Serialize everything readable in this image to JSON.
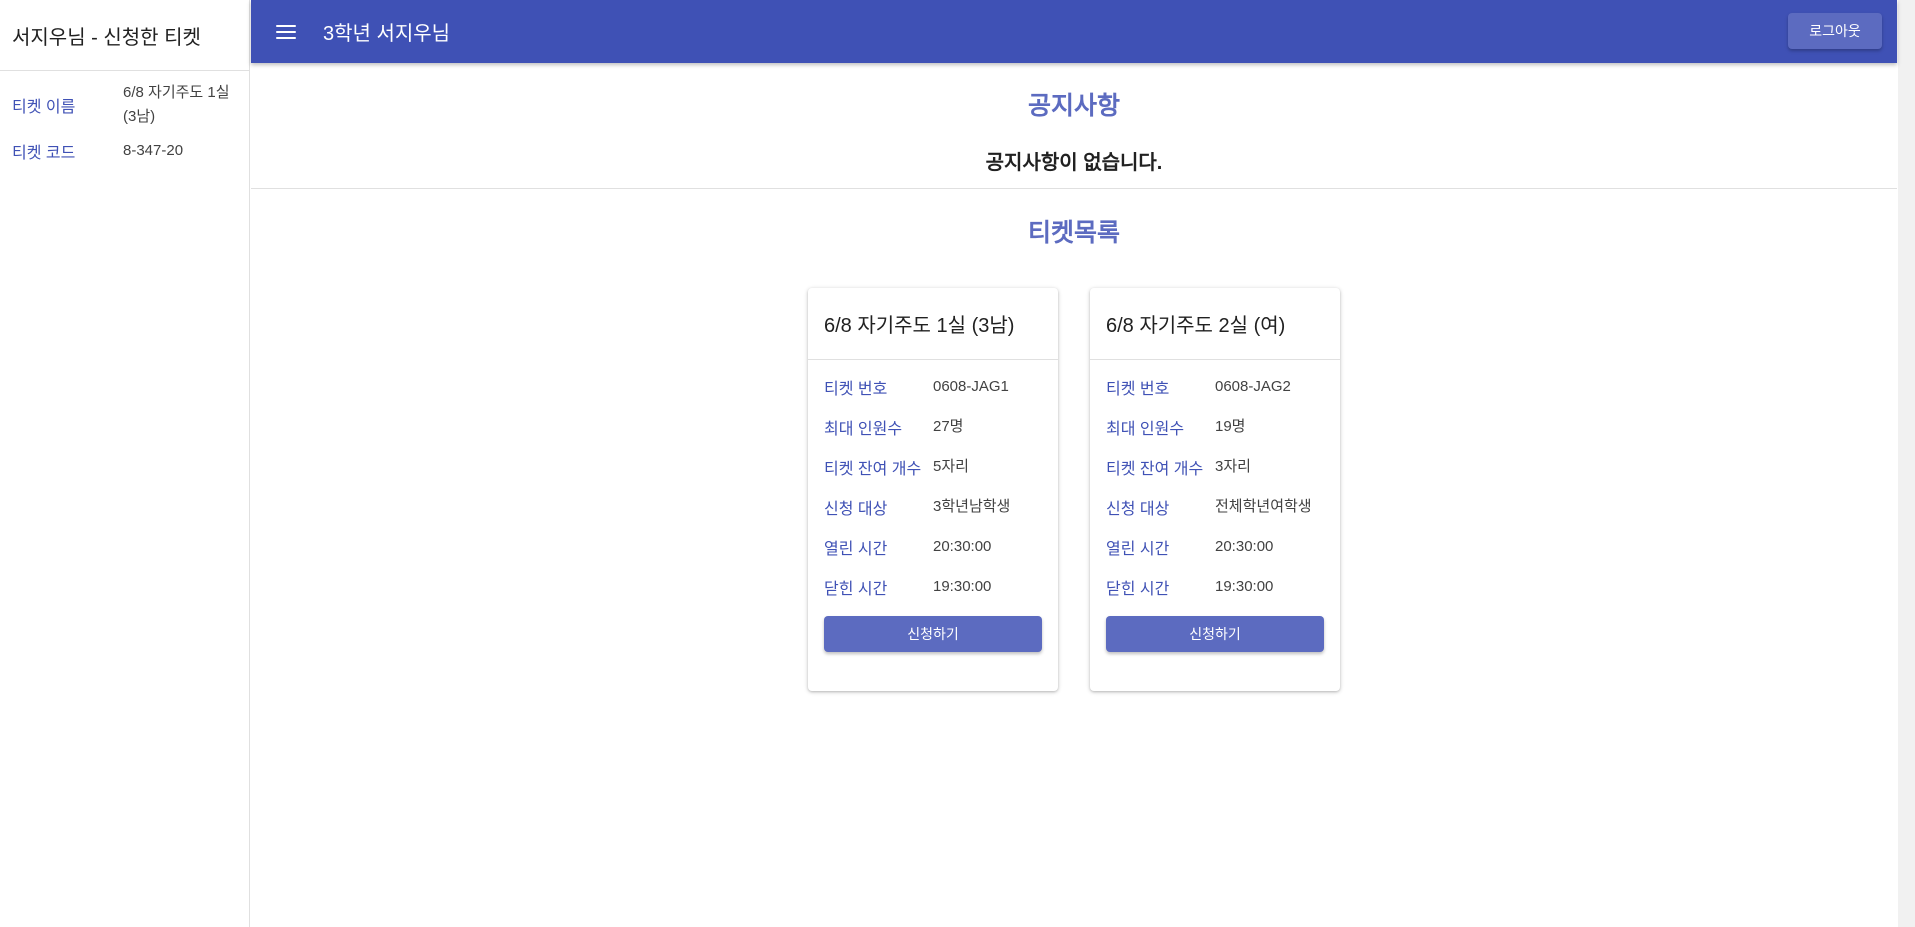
{
  "sidebar": {
    "title": "서지우님 - 신청한 티켓",
    "items": [
      {
        "label": "티켓 이름",
        "value": "6/8 자기주도 1실 (3남)"
      },
      {
        "label": "티켓 코드",
        "value": "8-347-20"
      }
    ]
  },
  "appbar": {
    "title": "3학년 서지우님",
    "logout_label": "로그아웃"
  },
  "notice": {
    "title": "공지사항",
    "message": "공지사항이 없습니다."
  },
  "tickets": {
    "title": "티켓목록",
    "cards": [
      {
        "title": "6/8 자기주도 1실 (3남)",
        "rows": [
          {
            "label": "티켓 번호",
            "value": "0608-JAG1"
          },
          {
            "label": "최대 인원수",
            "value": "27명"
          },
          {
            "label": "티켓 잔여 개수",
            "value": "5자리"
          },
          {
            "label": "신청 대상",
            "value": "3학년남학생"
          },
          {
            "label": "열린 시간",
            "value": "20:30:00"
          },
          {
            "label": "닫힌 시간",
            "value": "19:30:00"
          }
        ],
        "button_label": "신청하기"
      },
      {
        "title": "6/8 자기주도 2실 (여)",
        "rows": [
          {
            "label": "티켓 번호",
            "value": "0608-JAG2"
          },
          {
            "label": "최대 인원수",
            "value": "19명"
          },
          {
            "label": "티켓 잔여 개수",
            "value": "3자리"
          },
          {
            "label": "신청 대상",
            "value": "전체학년여학생"
          },
          {
            "label": "열린 시간",
            "value": "20:30:00"
          },
          {
            "label": "닫힌 시간",
            "value": "19:30:00"
          }
        ],
        "button_label": "신청하기"
      }
    ]
  },
  "colors": {
    "primary": "#3f51b5",
    "accent": "#5c6bc0"
  }
}
